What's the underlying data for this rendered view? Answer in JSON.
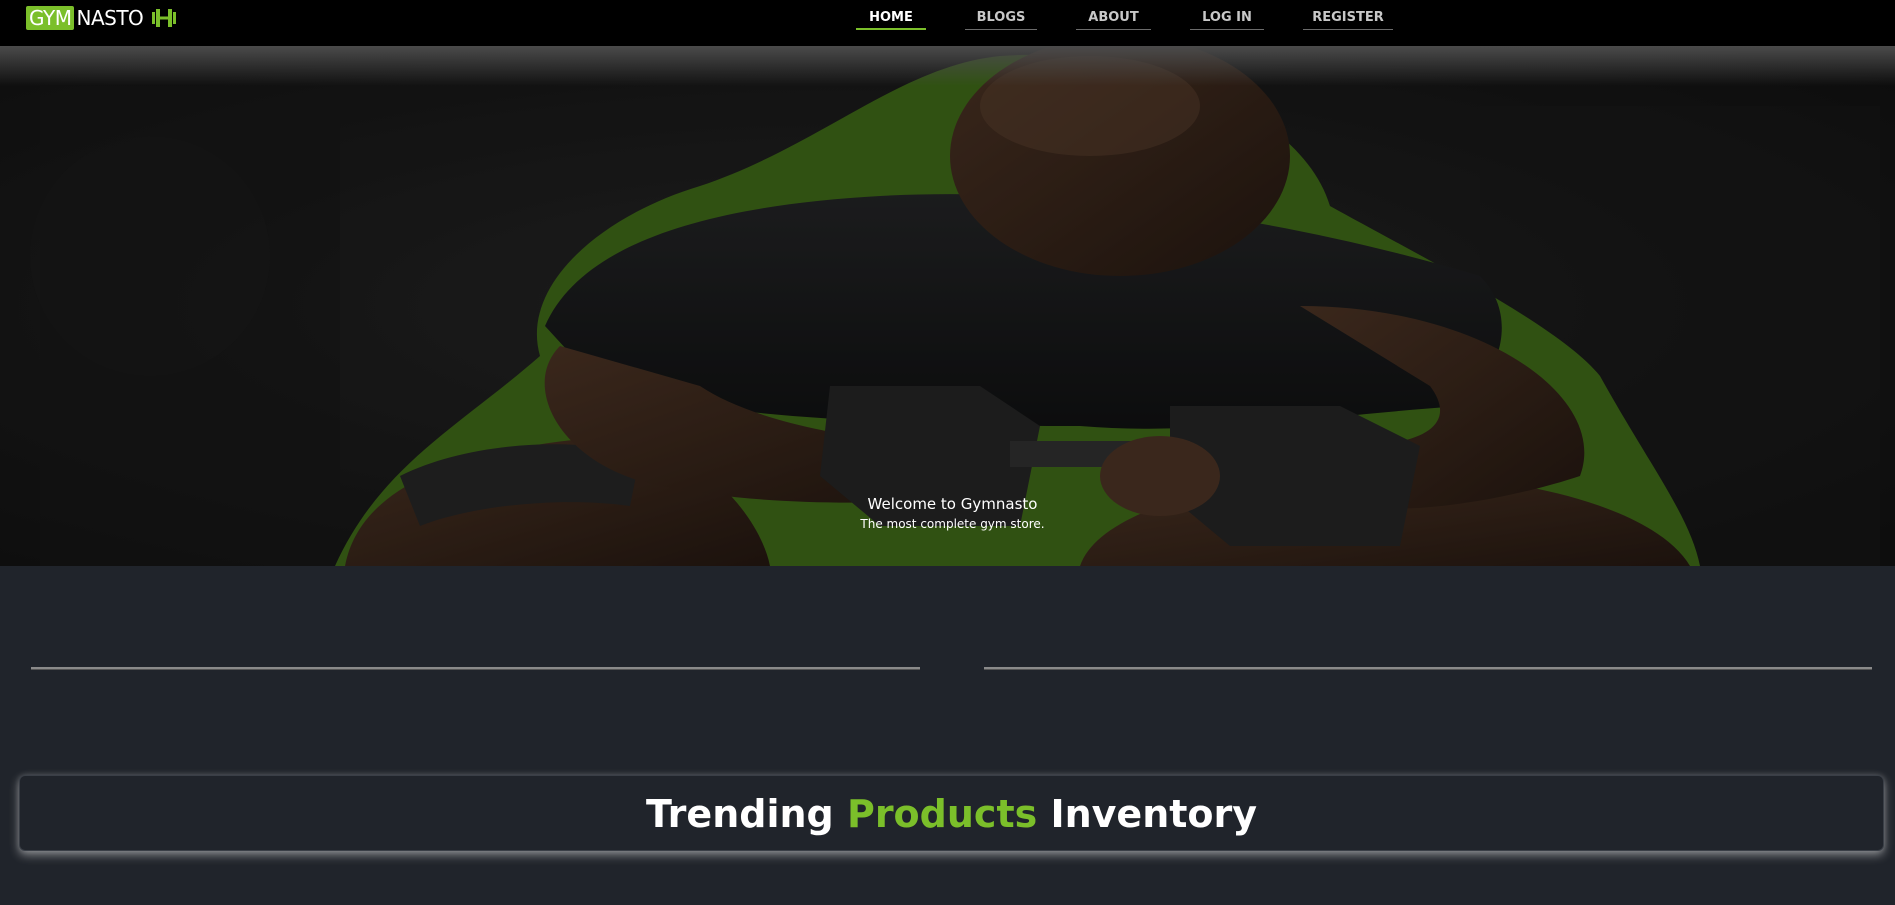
{
  "brand": {
    "logo_part1": "GYM",
    "logo_part2": "NASTO",
    "logo_icon": "dumbbell-icon",
    "accent_color": "#7bbf2a"
  },
  "nav": {
    "items": [
      {
        "label": "HOME",
        "active": true
      },
      {
        "label": "BLOGS",
        "active": false
      },
      {
        "label": "ABOUT",
        "active": false
      },
      {
        "label": "LOG IN",
        "active": false
      },
      {
        "label": "REGISTER",
        "active": false
      }
    ]
  },
  "hero": {
    "title": "Welcome to Gymnasto",
    "subtitle": "The most complete gym store."
  },
  "trending": {
    "word1": "Trending",
    "word2": "Products",
    "word3": "Inventory"
  },
  "colors": {
    "page_bg": "#20242b",
    "nav_bg": "#000000"
  }
}
